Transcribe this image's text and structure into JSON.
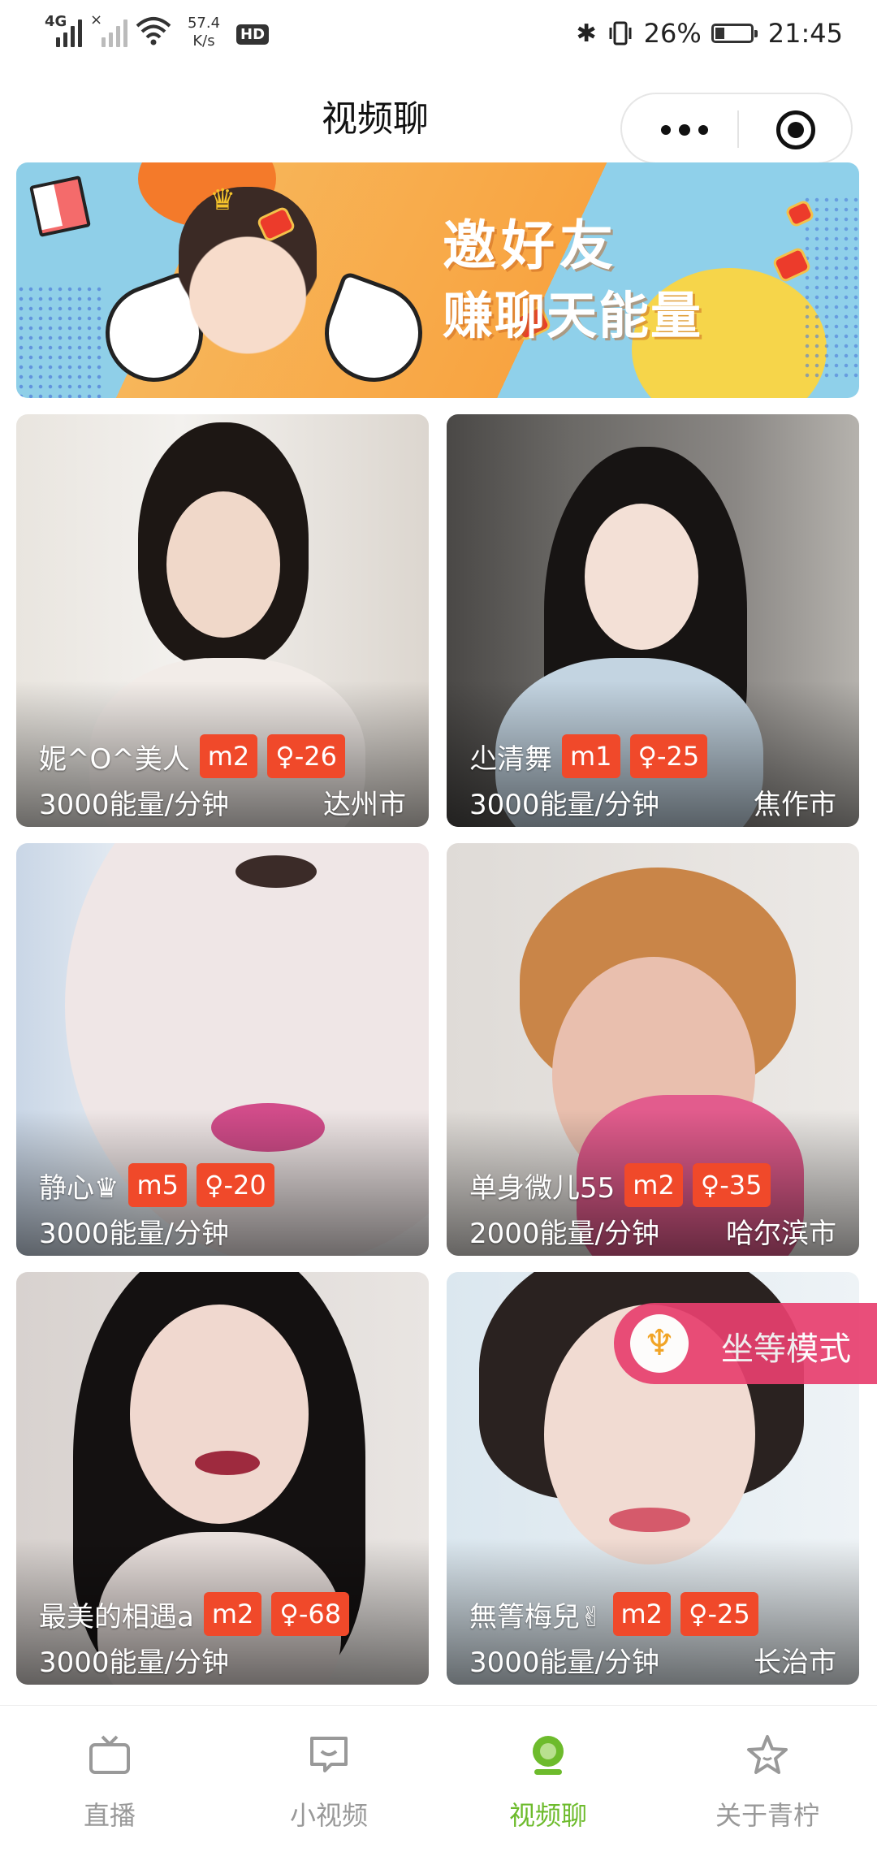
{
  "status_bar": {
    "network_type": "4G",
    "speed_value": "57.4",
    "speed_unit": "K/s",
    "hd": "HD",
    "battery": "26%",
    "battery_level": 0.26,
    "time": "21:45"
  },
  "header": {
    "title": "视频聊"
  },
  "banner": {
    "line1": "邀好友",
    "line2": "赚聊天能量"
  },
  "cards": [
    {
      "name": "妮^O^美人",
      "level": "m2",
      "age": "♀-26",
      "rate": "3000能量/分钟",
      "city": "达州市"
    },
    {
      "name": "尐清舞",
      "level": "m1",
      "age": "♀-25",
      "rate": "3000能量/分钟",
      "city": "焦作市"
    },
    {
      "name": "静心♛",
      "level": "m5",
      "age": "♀-20",
      "rate": "3000能量/分钟",
      "city": ""
    },
    {
      "name": "单身微儿55",
      "level": "m2",
      "age": "♀-35",
      "rate": "2000能量/分钟",
      "city": "哈尔滨市"
    },
    {
      "name": "最美的相遇a",
      "level": "m2",
      "age": "♀-68",
      "rate": "3000能量/分钟",
      "city": ""
    },
    {
      "name": "無箐梅兒✌",
      "level": "m2",
      "age": "♀-25",
      "rate": "3000能量/分钟",
      "city": "长治市"
    }
  ],
  "mode_button": {
    "label": "坐等模式",
    "icon": "trident-icon"
  },
  "tabs": [
    {
      "label": "直播",
      "icon": "tv-icon",
      "active": false
    },
    {
      "label": "小视频",
      "icon": "chat-bubble-icon",
      "active": false
    },
    {
      "label": "视频聊",
      "icon": "webcam-icon",
      "active": true
    },
    {
      "label": "关于青柠",
      "icon": "star-icon",
      "active": false
    }
  ],
  "colors": {
    "accent_green": "#6dbb2c",
    "badge_orange": "#f0492a",
    "mode_pink": "#e8406f"
  }
}
